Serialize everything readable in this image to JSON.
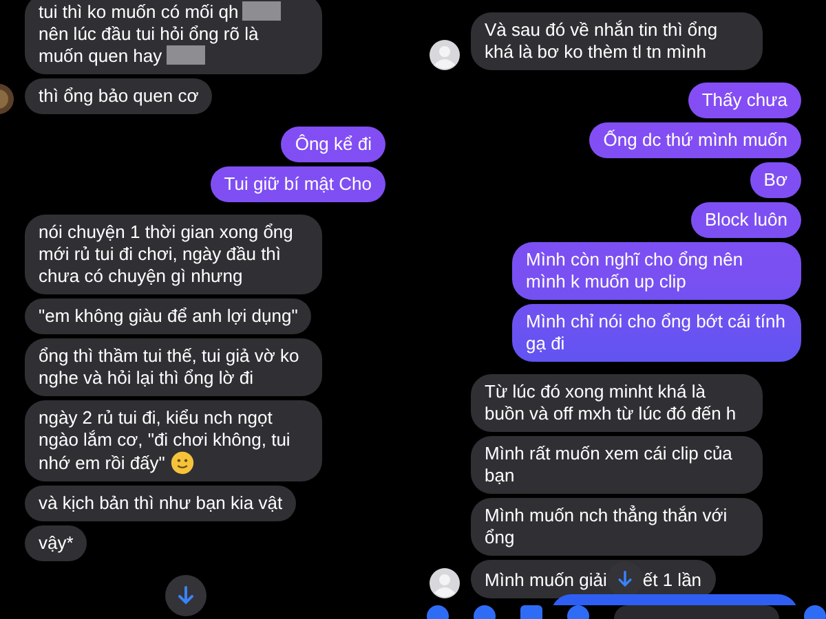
{
  "panels": [
    {
      "groups": [
        {
          "kind": "them",
          "messages": [
            {
              "segments": [
                {
                  "kind": "text",
                  "text": "tui thì ko muốn có mối qh"
                },
                {
                  "kind": "redaction"
                },
                {
                  "kind": "text",
                  "text": "nên lúc đầu tui hỏi ổng rõ là"
                },
                {
                  "kind": "text",
                  "text": "muốn quen hay"
                },
                {
                  "kind": "redaction"
                }
              ]
            },
            {
              "text": "thì ổng bảo quen cơ",
              "avatar": true
            }
          ]
        },
        {
          "kind": "me",
          "messages": [
            {
              "text": "Ông kể đi"
            },
            {
              "text": "Tui giữ bí mật Cho"
            }
          ]
        },
        {
          "kind": "them",
          "messages": [
            {
              "text": "nói chuyện 1 thời gian xong ổng mới rủ tui đi chơi, ngày đầu thì chưa có chuyện gì nhưng"
            },
            {
              "text": "\"em không giàu để anh lợi dụng\""
            },
            {
              "text": "ổng thì thầm tui thế, tui giả vờ ko nghe và hỏi lại thì ổng lờ đi"
            },
            {
              "segments": [
                {
                  "kind": "text",
                  "text": "ngày 2 rủ tui đi, kiểu nch ngọt ngào lắm cơ, \"đi chơi không, tui"
                },
                {
                  "kind": "text",
                  "text": "nhớ em rồi đấy\""
                },
                {
                  "kind": "emoji"
                }
              ]
            },
            {
              "text": "và kịch bản thì như bạn kia vật"
            },
            {
              "text": "vậy*"
            }
          ]
        }
      ]
    },
    {
      "groups": [
        {
          "kind": "them",
          "messages": [
            {
              "text": "Và sau đó về nhắn tin thì ổng khá là bơ ko thèm tl tn mình",
              "avatar": true
            }
          ]
        },
        {
          "kind": "me",
          "messages": [
            {
              "text": "Thấy chưa"
            },
            {
              "text": "Ống dc thứ mình muốn"
            },
            {
              "text": "Bơ"
            },
            {
              "text": "Block luôn"
            },
            {
              "text": "Mình còn nghĩ cho ổng nên mình k muốn up clip"
            },
            {
              "text": "Mình chỉ nói cho ổng bớt cái tính gạ đi"
            }
          ]
        },
        {
          "kind": "them",
          "messages": [
            {
              "text": "Từ lúc đó xong minht khá là buồn và off mxh từ lúc đó đến h"
            },
            {
              "text": "Mình rất muốn xem cái clip của bạn"
            },
            {
              "text": "Mình muốn nch thẳng thắn với ổng"
            },
            {
              "segments": [
                {
                  "kind": "text",
                  "text": "Mình muốn giải"
                },
                {
                  "kind": "covered"
                },
                {
                  "kind": "text",
                  "text": "ết 1 lần"
                }
              ],
              "avatar": true
            }
          ]
        }
      ]
    }
  ]
}
